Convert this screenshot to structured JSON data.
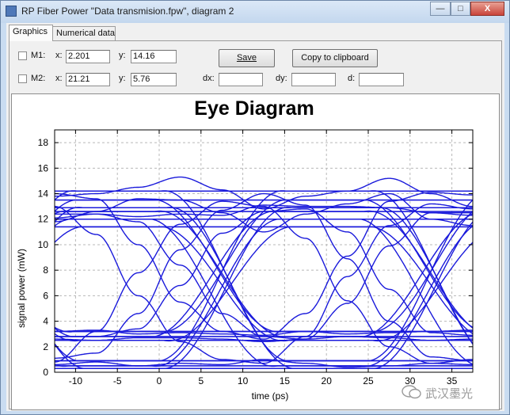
{
  "window": {
    "title": "RP Fiber Power \"Data transmision.fpw\", diagram 2",
    "minimize": "—",
    "maximize": "□",
    "close": "X"
  },
  "tabs": [
    {
      "label": "Graphics",
      "active": true
    },
    {
      "label": "Numerical data",
      "active": false
    }
  ],
  "markers": {
    "m1": {
      "label": "M1:",
      "x_label": "x:",
      "x_value": "2.201",
      "y_label": "y:",
      "y_value": "14.16",
      "checked": false
    },
    "m2": {
      "label": "M2:",
      "x_label": "x:",
      "x_value": "21.21",
      "y_label": "y:",
      "y_value": "5.76",
      "checked": false
    }
  },
  "deltas": {
    "dx_label": "dx:",
    "dx_value": "",
    "dy_label": "dy:",
    "dy_value": "",
    "d_label": "d:",
    "d_value": ""
  },
  "buttons": {
    "save": "Save",
    "copy": "Copy to clipboard"
  },
  "watermark": "武汉墨光",
  "chart_data": {
    "type": "line",
    "title": "Eye Diagram",
    "xlabel": "time (ps)",
    "ylabel": "signal power (mW)",
    "xlim": [
      -12.5,
      37.5
    ],
    "ylim": [
      0,
      19
    ],
    "xticks": [
      -10,
      -5,
      0,
      5,
      10,
      15,
      20,
      25,
      30,
      35
    ],
    "yticks": [
      0,
      2,
      4,
      6,
      8,
      10,
      12,
      14,
      16,
      18
    ],
    "grid": true,
    "line_color": "#1a1adb",
    "transition_centers": [
      7.5,
      32.5,
      -17.5
    ],
    "one_levels": [
      12.0,
      12.6,
      13.5,
      14.2,
      11.4,
      12.9
    ],
    "zero_levels": [
      0.5,
      2.8,
      3.2,
      0.9,
      2.5,
      0.3
    ],
    "series": [
      {
        "x": [
          -12.5,
          -7.5,
          -2.5,
          2.5,
          7.5,
          12.5,
          17.5,
          22.5,
          27.5,
          32.5,
          37.5
        ],
        "y": [
          12.4,
          12.4,
          12.2,
          12.4,
          12.3,
          13.1,
          13.0,
          13.0,
          12.9,
          12.5,
          12.5
        ]
      },
      {
        "x": [
          -12.5,
          -7.5,
          -2.5,
          2.5,
          7.5,
          12.5,
          17.5,
          22.5,
          27.5,
          32.5,
          37.5
        ],
        "y": [
          13.8,
          14.0,
          14.5,
          15.3,
          14.3,
          12.8,
          13.8,
          14.2,
          15.2,
          14.0,
          13.0
        ]
      },
      {
        "x": [
          -12.5,
          -7.5,
          -2.5,
          2.5,
          7.5,
          12.5,
          17.5,
          22.5,
          27.5,
          32.5,
          37.5
        ],
        "y": [
          11.8,
          12.6,
          13.6,
          13.5,
          12.5,
          11.0,
          12.4,
          13.2,
          14.0,
          12.0,
          11.5
        ]
      },
      {
        "x": [
          -12.5,
          -7.5,
          -2.5,
          2.5,
          7.5,
          12.5,
          17.5,
          22.5,
          27.5,
          32.5,
          37.5
        ],
        "y": [
          0.6,
          0.8,
          0.5,
          0.7,
          0.6,
          1.0,
          0.7,
          0.4,
          0.5,
          0.7,
          0.6
        ]
      },
      {
        "x": [
          -12.5,
          -7.5,
          -2.5,
          2.5,
          7.5,
          12.5,
          17.5,
          22.5,
          27.5,
          32.5,
          37.5
        ],
        "y": [
          3.2,
          3.3,
          3.0,
          3.1,
          3.0,
          2.9,
          3.2,
          3.0,
          3.1,
          3.2,
          3.3
        ]
      },
      {
        "x": [
          -12.5,
          -7.5,
          -2.5,
          2.5,
          7.5,
          12.5,
          17.5,
          22.5,
          27.5,
          32.5,
          37.5
        ],
        "y": [
          2.6,
          2.5,
          2.7,
          2.7,
          2.6,
          2.4,
          2.6,
          2.8,
          2.7,
          2.5,
          2.6
        ]
      },
      {
        "x": [
          -12.5,
          -7.5,
          -2.5,
          2.5,
          7.5,
          12.5,
          17.5,
          22.5,
          27.5,
          32.5,
          37.5
        ],
        "y": [
          13.0,
          10.8,
          6.0,
          2.4,
          1.0,
          0.7,
          2.8,
          7.5,
          11.5,
          13.2,
          12.8
        ]
      },
      {
        "x": [
          -12.5,
          -7.5,
          -2.5,
          2.5,
          7.5,
          12.5,
          17.5,
          22.5,
          27.5,
          32.5,
          37.5
        ],
        "y": [
          0.8,
          3.2,
          7.8,
          11.6,
          13.4,
          13.0,
          10.5,
          5.6,
          2.0,
          0.7,
          1.0
        ]
      },
      {
        "x": [
          -12.5,
          -7.5,
          -2.5,
          2.5,
          7.5,
          12.5,
          17.5,
          22.5,
          27.5,
          32.5,
          37.5
        ],
        "y": [
          12.1,
          12.4,
          11.8,
          8.4,
          4.6,
          2.8,
          2.6,
          5.4,
          9.9,
          12.5,
          12.3
        ]
      },
      {
        "x": [
          -12.5,
          -7.5,
          -2.5,
          2.5,
          7.5,
          12.5,
          17.5,
          22.5,
          27.5,
          32.5,
          37.5
        ],
        "y": [
          2.8,
          2.8,
          3.4,
          6.8,
          10.9,
          12.6,
          12.8,
          11.0,
          6.5,
          3.1,
          2.9
        ]
      },
      {
        "x": [
          -12.5,
          -7.5,
          -2.5,
          2.5,
          7.5,
          12.5,
          17.5,
          22.5,
          27.5,
          32.5,
          37.5
        ],
        "y": [
          14.0,
          13.6,
          10.0,
          5.5,
          3.2,
          2.6,
          4.6,
          9.1,
          13.4,
          14.1,
          13.9
        ]
      },
      {
        "x": [
          -12.5,
          -7.5,
          -2.5,
          2.5,
          7.5,
          12.5,
          17.5,
          22.5,
          27.5,
          32.5,
          37.5
        ],
        "y": [
          1.1,
          1.5,
          4.6,
          9.6,
          12.7,
          14.0,
          13.1,
          8.9,
          4.0,
          1.2,
          0.9
        ]
      }
    ]
  }
}
